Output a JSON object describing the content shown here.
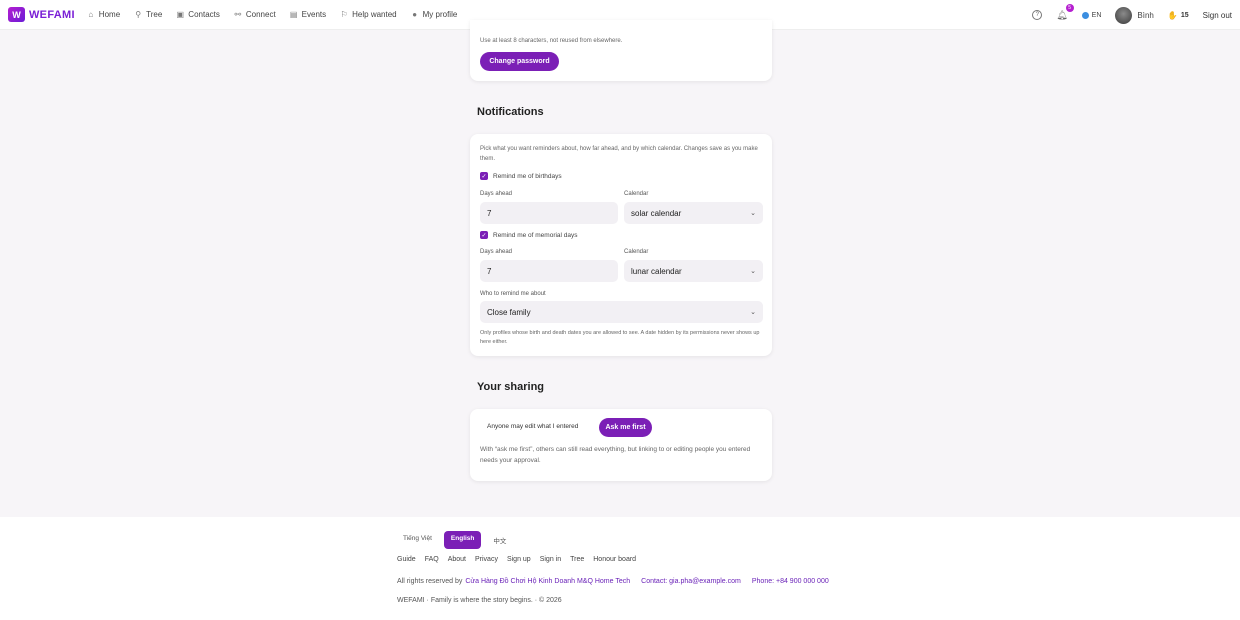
{
  "header": {
    "logo_text": "WEFAMI",
    "nav": [
      {
        "label": "Home",
        "icon": "home-icon"
      },
      {
        "label": "Tree",
        "icon": "tree-icon"
      },
      {
        "label": "Contacts",
        "icon": "contacts-icon"
      },
      {
        "label": "Connect",
        "icon": "connect-icon"
      },
      {
        "label": "Events",
        "icon": "calendar-icon"
      },
      {
        "label": "Help wanted",
        "icon": "help-wanted-icon"
      },
      {
        "label": "My profile",
        "icon": "person-icon"
      }
    ],
    "notification_count": "5",
    "language": "EN",
    "user_name": "Bình",
    "coins": "15",
    "sign_out": "Sign out"
  },
  "password": {
    "hint": "Use at least 8 characters, not reused from elsewhere.",
    "change_button": "Change password"
  },
  "notifications": {
    "title": "Notifications",
    "description": "Pick what you want reminders about, how far ahead, and by which calendar. Changes save as you make them.",
    "birthdays": {
      "checkbox_label": "Remind me of birthdays",
      "checked": true,
      "days_label": "Days ahead",
      "days_value": "7",
      "calendar_label": "Calendar",
      "calendar_value": "solar calendar"
    },
    "memorials": {
      "checkbox_label": "Remind me of memorial days",
      "checked": true,
      "days_label": "Days ahead",
      "days_value": "7",
      "calendar_label": "Calendar",
      "calendar_value": "lunar calendar"
    },
    "who_label": "Who to remind me about",
    "who_value": "Close family",
    "who_hint": "Only profiles whose birth and death dates you are allowed to see. A date hidden by its permissions never shows up here either."
  },
  "sharing": {
    "title": "Your sharing",
    "option_anyone": "Anyone may edit what I entered",
    "option_ask": "Ask me first",
    "selected": "Ask me first",
    "hint": "With “ask me first”, others can still read everything, but linking to or editing people you entered needs your approval."
  },
  "footer": {
    "languages": [
      "Tiếng Việt",
      "English",
      "中文"
    ],
    "active_language": "English",
    "links": [
      "Guide",
      "FAQ",
      "About",
      "Privacy",
      "Sign up",
      "Sign in",
      "Tree",
      "Honour board"
    ],
    "rights_prefix": "All rights reserved by",
    "company": "Cửa Hàng Đồ Chơi Hộ Kinh Doanh M&Q Home Tech",
    "contact": "Contact: gia.pha@example.com",
    "phone": "Phone: +84 900 000 000",
    "tagline": "WEFAMI · Family is where the story begins. · © 2026"
  },
  "colors": {
    "accent": "#7b1fb6",
    "background": "#f7f5f8"
  }
}
